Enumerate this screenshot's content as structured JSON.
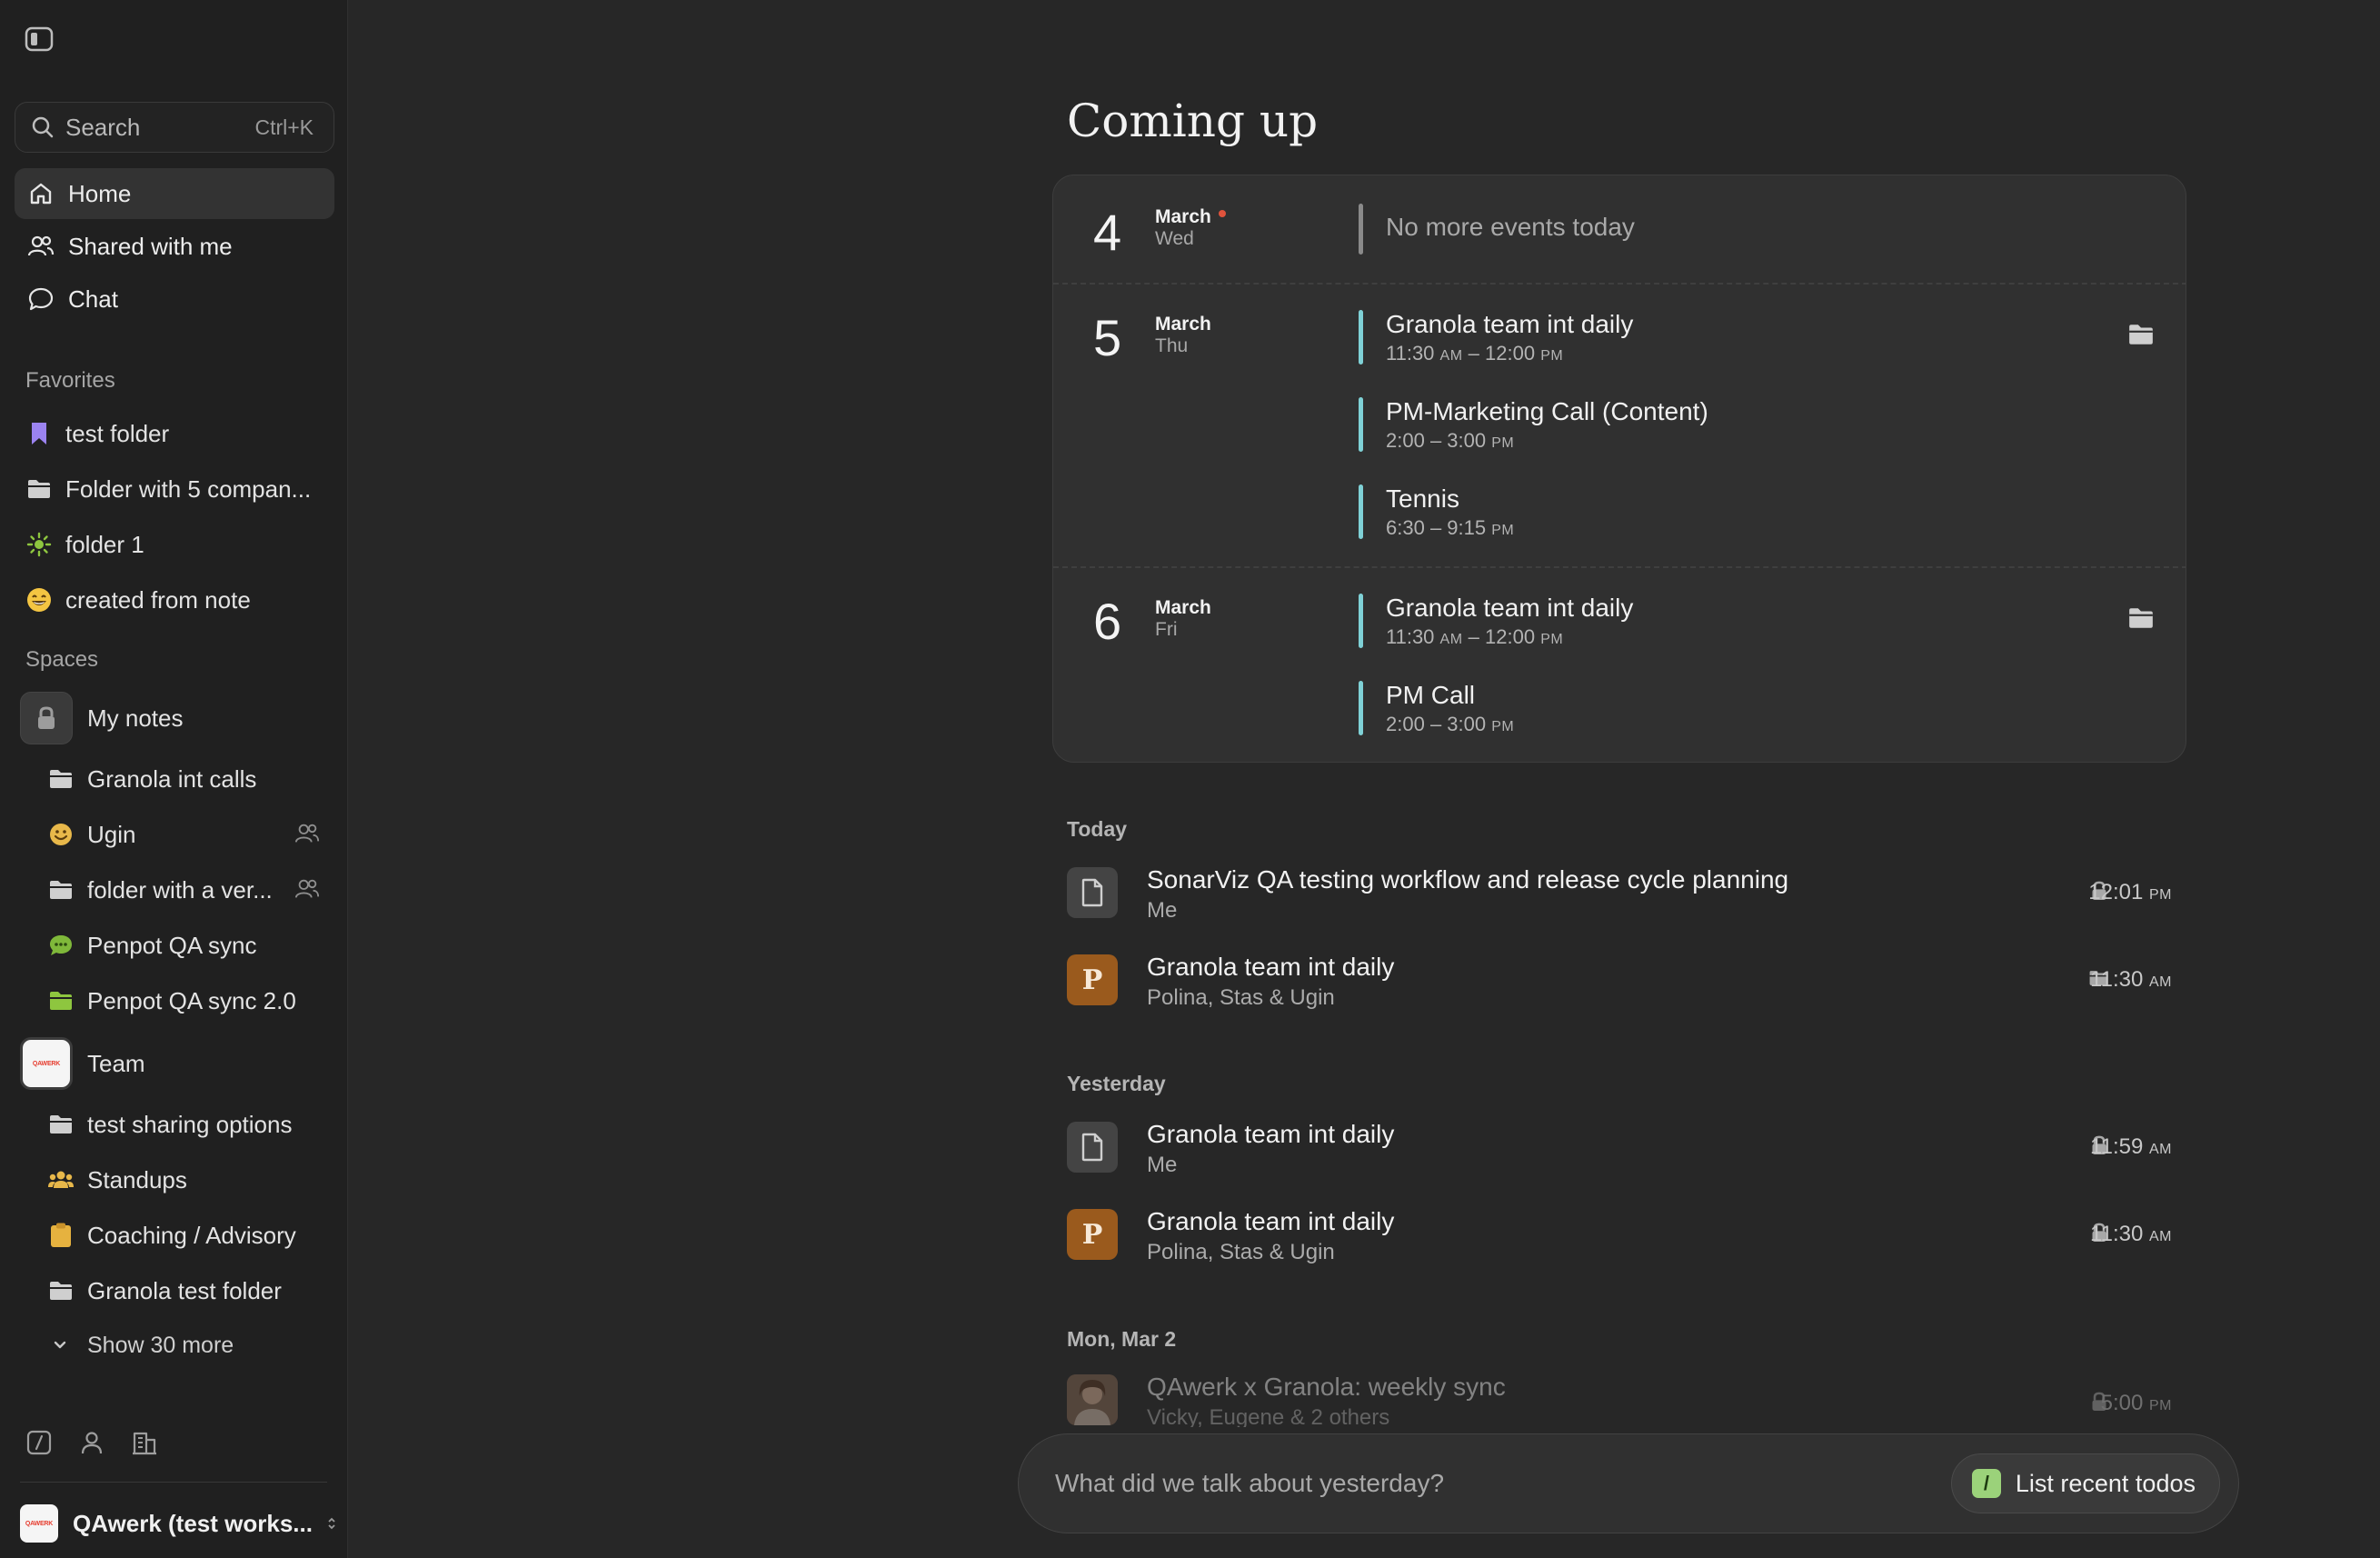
{
  "sidebar": {
    "search": {
      "placeholder": "Search",
      "shortcut": "Ctrl+K"
    },
    "nav": [
      {
        "label": "Home",
        "icon": "home-icon",
        "active": true
      },
      {
        "label": "Shared with me",
        "icon": "users-icon"
      },
      {
        "label": "Chat",
        "icon": "chat-bubble-icon"
      }
    ],
    "favorites_label": "Favorites",
    "favorites": [
      {
        "label": "test folder",
        "icon": "bookmark-icon"
      },
      {
        "label": "Folder with 5 compan...",
        "icon": "folder-icon"
      },
      {
        "label": "folder 1",
        "icon": "sun-icon"
      },
      {
        "label": "created from note",
        "icon": "grinning-face-icon"
      }
    ],
    "spaces_label": "Spaces",
    "spaces": {
      "my_notes": {
        "label": "My notes",
        "children": [
          {
            "label": "Granola int calls",
            "icon": "folder-icon"
          },
          {
            "label": "Ugin",
            "icon": "smiley-icon"
          },
          {
            "label": "folder with a ver...",
            "icon": "folder-icon"
          },
          {
            "label": "Penpot QA sync",
            "icon": "speech-bubble-icon"
          },
          {
            "label": "Penpot QA sync 2.0",
            "icon": "folder-icon"
          }
        ]
      },
      "team": {
        "label": "Team",
        "logo_text": "QAWERK",
        "children": [
          {
            "label": "test sharing options",
            "icon": "folder-icon"
          },
          {
            "label": "Standups",
            "icon": "people-icon"
          },
          {
            "label": "Coaching / Advisory",
            "icon": "clipboard-icon"
          },
          {
            "label": "Granola test folder",
            "icon": "folder-icon"
          }
        ]
      }
    },
    "show_more": "Show 30 more",
    "workspace": {
      "name": "QAwerk (test works...",
      "logo_text": "QAWERK"
    }
  },
  "main": {
    "title": "Coming up",
    "calendar": [
      {
        "day": "4",
        "month": "March",
        "weekday": "Wed",
        "is_today": true,
        "empty_text": "No more events today"
      },
      {
        "day": "5",
        "month": "March",
        "weekday": "Thu",
        "events": [
          {
            "title": "Granola team int daily",
            "start": "11:30",
            "start_ampm": "AM",
            "end": "12:00",
            "end_ampm": "PM",
            "has_folder": true
          },
          {
            "title": "PM-Marketing Call (Content)",
            "start": "2:00",
            "end": "3:00",
            "end_ampm": "PM"
          },
          {
            "title": "Tennis",
            "start": "6:30",
            "end": "9:15",
            "end_ampm": "PM"
          }
        ]
      },
      {
        "day": "6",
        "month": "March",
        "weekday": "Fri",
        "events": [
          {
            "title": "Granola team int daily",
            "start": "11:30",
            "start_ampm": "AM",
            "end": "12:00",
            "end_ampm": "PM",
            "has_folder": true
          },
          {
            "title": "PM Call",
            "start": "2:00",
            "end": "3:00",
            "end_ampm": "PM"
          }
        ]
      }
    ],
    "groups": [
      {
        "label": "Today",
        "notes": [
          {
            "title": "SonarViz QA testing workflow and release cycle planning",
            "sub": "Me",
            "icon": "document-icon",
            "status": "lock-icon",
            "time": "12:01",
            "ampm": "PM"
          },
          {
            "title": "Granola team int daily",
            "sub": "Polina, Stas & Ugin",
            "icon": "P",
            "status": "folder-icon",
            "time": "11:30",
            "ampm": "AM"
          }
        ]
      },
      {
        "label": "Yesterday",
        "notes": [
          {
            "title": "Granola team int daily",
            "sub": "Me",
            "icon": "document-icon",
            "status": "lock-icon",
            "time": "11:59",
            "ampm": "AM"
          },
          {
            "title": "Granola team int daily",
            "sub": "Polina, Stas & Ugin",
            "icon": "P",
            "status": "lock-icon",
            "time": "11:30",
            "ampm": "AM"
          }
        ]
      },
      {
        "label": "Mon, Mar 2",
        "notes": [
          {
            "title": "QAwerk x Granola: weekly sync",
            "sub": "Vicky, Eugene & 2 others",
            "icon": "photo-avatar-icon",
            "status": "lock-icon",
            "time": "5:00",
            "ampm": "PM"
          }
        ]
      }
    ],
    "chat": {
      "placeholder": "What did we talk about yesterday?",
      "suggestion": "List recent todos",
      "suggestion_icon": "/"
    }
  }
}
